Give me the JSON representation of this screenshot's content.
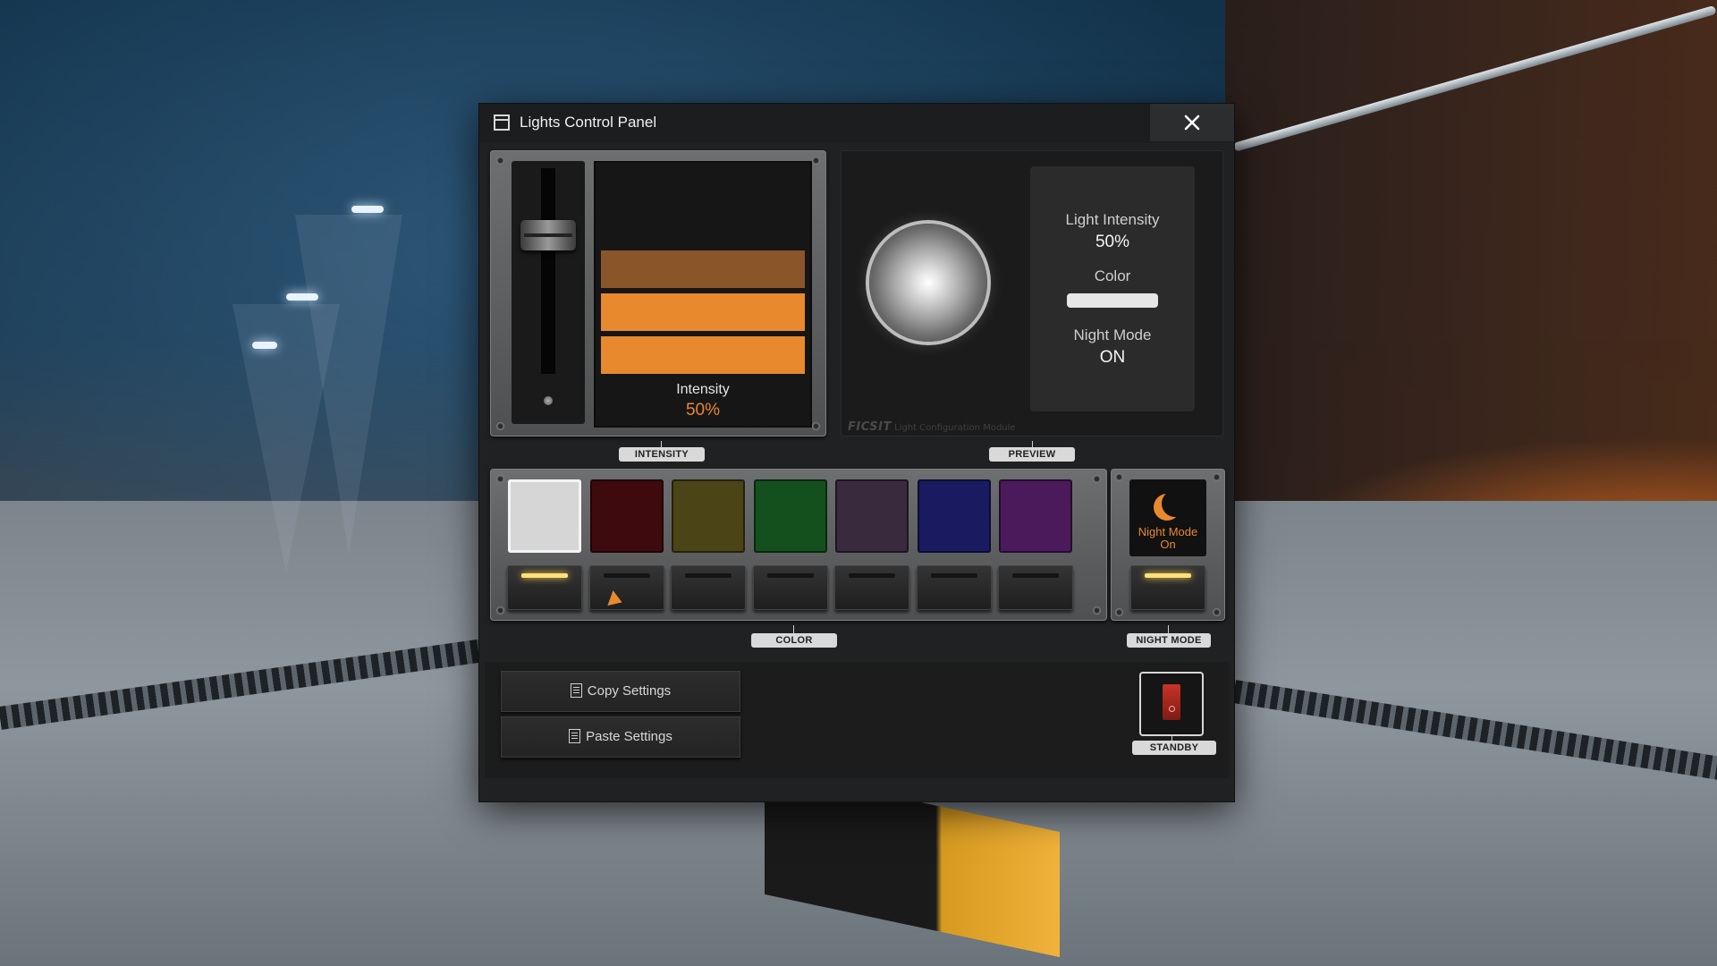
{
  "window": {
    "title": "Lights Control Panel",
    "close_label": "✕"
  },
  "intensity": {
    "label": "Intensity",
    "value_text": "50%",
    "level": 0.5,
    "bar_colors": [
      "#8a5528",
      "#e8892e",
      "#e8892e"
    ],
    "tag": "INTENSITY"
  },
  "preview": {
    "tag": "PREVIEW",
    "light_intensity_label": "Light Intensity",
    "light_intensity_value": "50%",
    "color_label": "Color",
    "color_value": "#e6e6e6",
    "night_mode_label": "Night Mode",
    "night_mode_value": "ON",
    "brand_logo": "FICSIT",
    "brand_caption": "Light Configuration Module"
  },
  "color": {
    "tag": "COLOR",
    "swatches": [
      {
        "color": "#d6d6d6",
        "selected": true
      },
      {
        "color": "#3e0a0d",
        "selected": false
      },
      {
        "color": "#4a4416",
        "selected": false
      },
      {
        "color": "#14501d",
        "selected": false
      },
      {
        "color": "#3a2a3e",
        "selected": false
      },
      {
        "color": "#1a1a60",
        "selected": false
      },
      {
        "color": "#4a1a5a",
        "selected": false
      }
    ]
  },
  "night_mode": {
    "tag": "NIGHT MODE",
    "status_text": "Night Mode On",
    "enabled": true,
    "icon": "moon-icon",
    "accent": "#e8892e"
  },
  "actions": {
    "copy_label": "Copy Settings",
    "paste_label": "Paste Settings"
  },
  "standby": {
    "tag": "STANDBY",
    "switch_color": "#c93328"
  }
}
